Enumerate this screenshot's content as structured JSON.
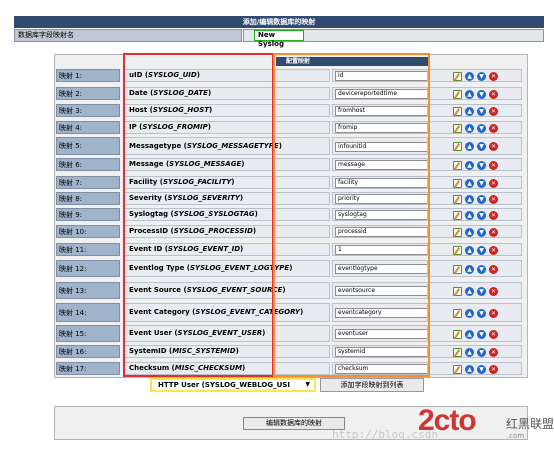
{
  "header": {
    "title": "添加/编辑数据库的映射"
  },
  "db_name": {
    "label": "数据库字段映射名",
    "value": "New Syslog"
  },
  "mapping_header": "配置映射",
  "rows": [
    {
      "num": "映射 1:",
      "name": "uID (",
      "src": "SYSLOG_UID",
      "close": ")",
      "field": "id"
    },
    {
      "num": "映射 2:",
      "name": "Date (",
      "src": "SYSLOG_DATE",
      "close": ")",
      "field": "devicereportedtime"
    },
    {
      "num": "映射 3:",
      "name": "Host (",
      "src": "SYSLOG_HOST",
      "close": ")",
      "field": "fromhost"
    },
    {
      "num": "映射 4:",
      "name": "IP (",
      "src": "SYSLOG_FROMIP",
      "close": ")",
      "field": "fromip"
    },
    {
      "num": "映射 5:",
      "name": "Messagetype (",
      "src": "SYSLOG_MESSAGETYPE",
      "close": ")",
      "field": "infounitid"
    },
    {
      "num": "映射 6:",
      "name": "Message (",
      "src": "SYSLOG_MESSAGE",
      "close": ")",
      "field": "message"
    },
    {
      "num": "映射 7:",
      "name": "Facility (",
      "src": "SYSLOG_FACILITY",
      "close": ")",
      "field": "facility"
    },
    {
      "num": "映射 8:",
      "name": "Severity (",
      "src": "SYSLOG_SEVERITY",
      "close": ")",
      "field": "priority"
    },
    {
      "num": "映射 9:",
      "name": "Syslogtag (",
      "src": "SYSLOG_SYSLOGTAG",
      "close": ")",
      "field": "syslogtag"
    },
    {
      "num": "映射 10:",
      "name": "ProcessID (",
      "src": "SYSLOG_PROCESSID",
      "close": ")",
      "field": "processid"
    },
    {
      "num": "映射 11:",
      "name": "Event ID (",
      "src": "SYSLOG_EVENT_ID",
      "close": ")",
      "field": "1"
    },
    {
      "num": "映射 12:",
      "name": "Eventlog Type (",
      "src": "SYSLOG_EVENT_LOGTYPE",
      "close": ")",
      "field": "eventlogtype"
    },
    {
      "num": "映射 13:",
      "name": "Event Source (",
      "src": "SYSLOG_EVENT_SOURCE",
      "close": ")",
      "field": "eventsource"
    },
    {
      "num": "映射 14:",
      "name": "Event Category (",
      "src": "SYSLOG_EVENT_CATEGORY",
      "close": ")",
      "field": "eventcategory"
    },
    {
      "num": "映射 15:",
      "name": "Event User (",
      "src": "SYSLOG_EVENT_USER",
      "close": ")",
      "field": "eventuser"
    },
    {
      "num": "映射 16:",
      "name": "SystemID (",
      "src": "MISC_SYSTEMID",
      "close": ")",
      "field": "systemid"
    },
    {
      "num": "映射 17:",
      "name": "Checksum (",
      "src": "MISC_CHECKSUM",
      "close": ")",
      "field": "checksum"
    }
  ],
  "add": {
    "select_value": "HTTP User (SYSLOG_WEBLOG_USI",
    "button": "添加字段映射到列表"
  },
  "save_button": "编辑数据库的映射",
  "icons": {
    "edit": "edit-icon",
    "up": "arrow-up-icon",
    "down": "arrow-down-icon",
    "delete": "delete-icon"
  },
  "watermark": {
    "url": "http://blog.csdn",
    "logo": "2cto",
    "cn": "红黑联盟",
    "sub": ".com"
  }
}
